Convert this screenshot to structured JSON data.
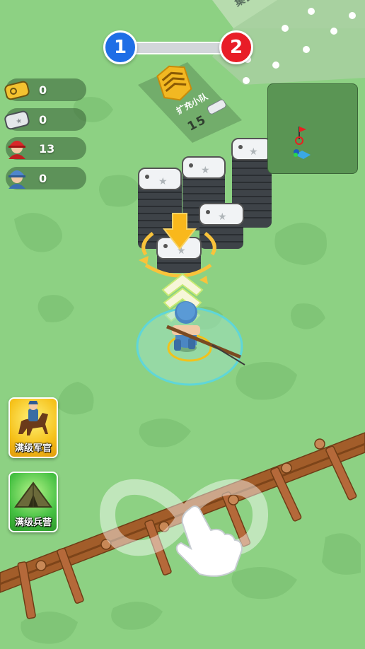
{
  "resources": [
    {
      "icon": "gold-coin-icon",
      "value": "0"
    },
    {
      "icon": "silver-plate-icon",
      "value": "0"
    },
    {
      "icon": "red-soldier-icon",
      "value": "13"
    },
    {
      "icon": "blue-soldier-icon",
      "value": "0"
    }
  ],
  "level_progress": {
    "current": "1",
    "next": "2",
    "progress": 0.0
  },
  "upgrade_zone": {
    "title": "扩充小队",
    "cost": "15"
  },
  "top_zone": {
    "label": "集合"
  },
  "buttons": {
    "officer_label": "满级军官",
    "barracks_label": "满级兵营"
  },
  "colors": {
    "ground": "#8dd183",
    "level_current": "#1f6ee6",
    "level_next": "#e81d27",
    "minimap_bg": "#5a9554"
  }
}
